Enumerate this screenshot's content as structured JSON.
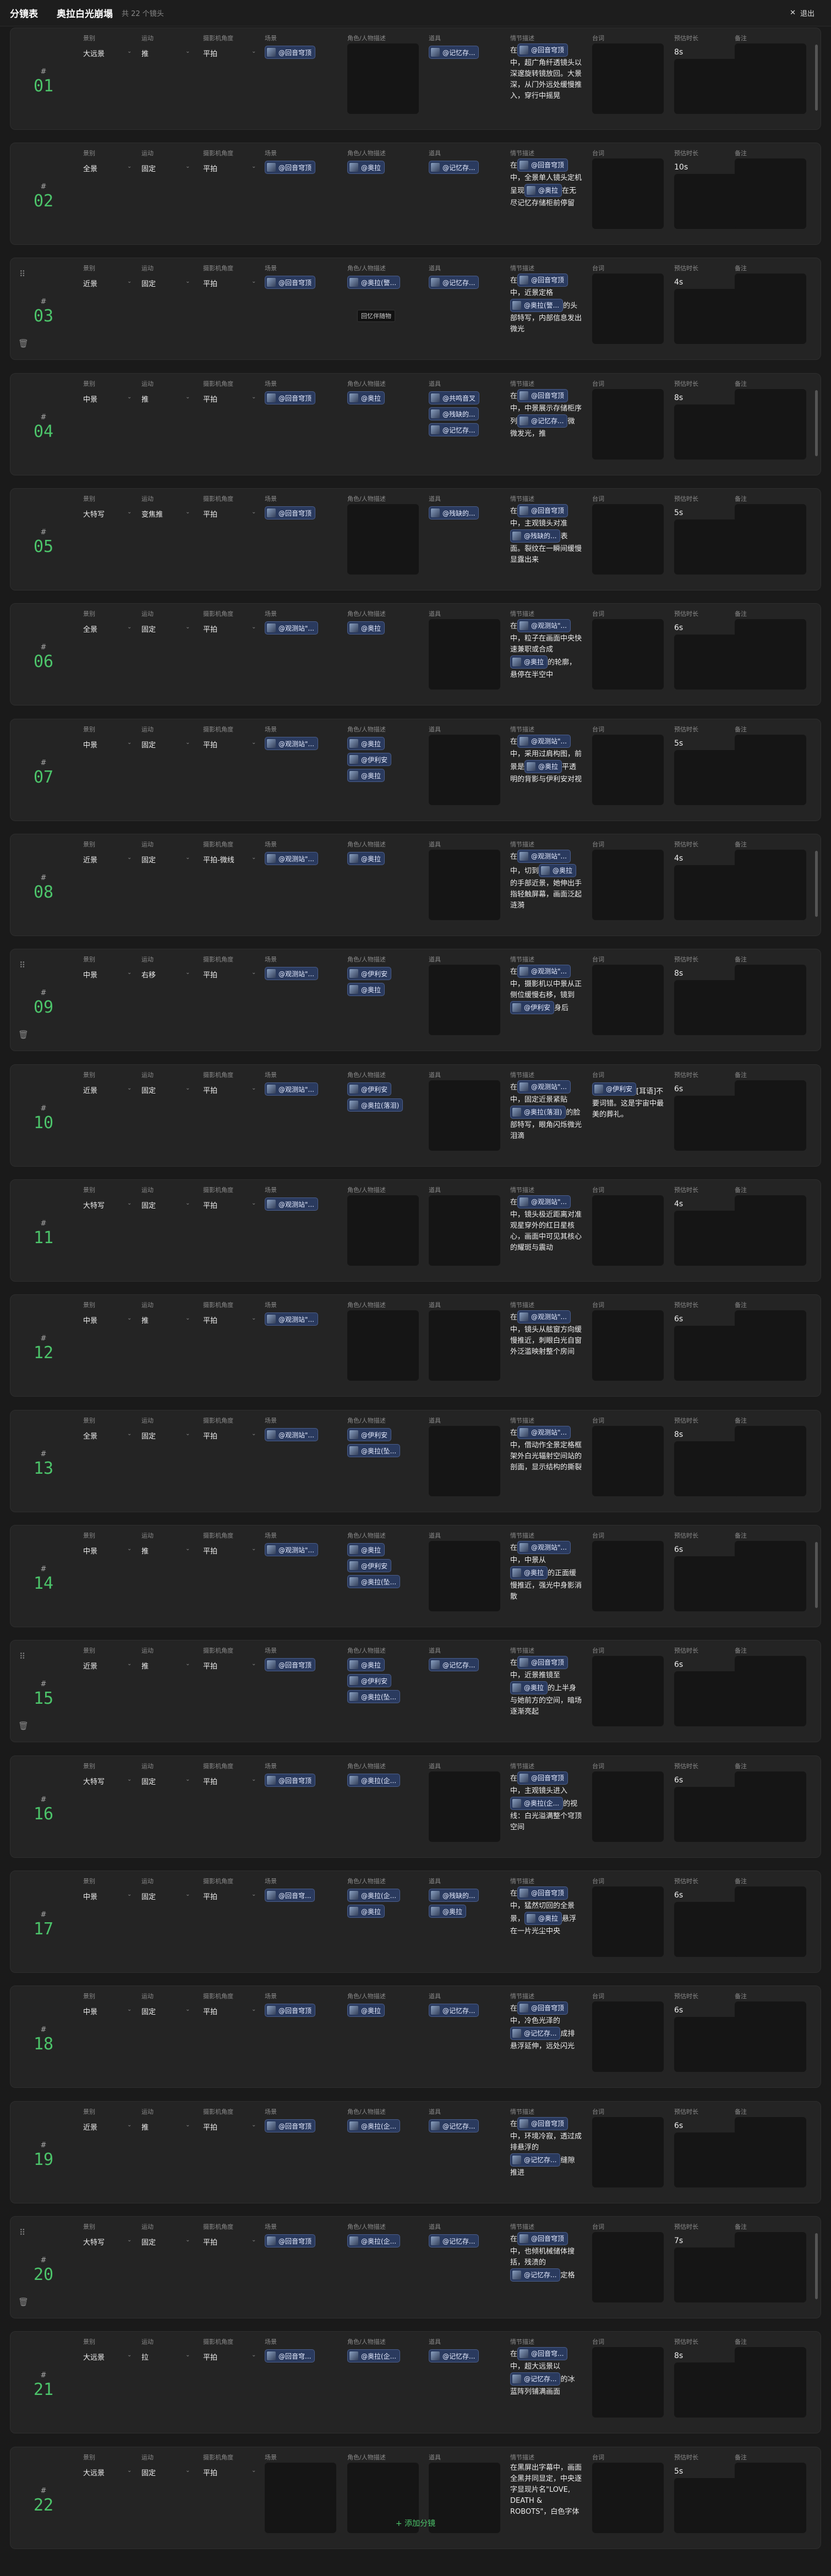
{
  "header": {
    "title": "分镜表",
    "project": "奥拉白光崩塌",
    "count": "共 22 个镜头",
    "exit": "退出",
    "exit_icon": "close-icon"
  },
  "labels": {
    "shot": "景别",
    "move": "运动",
    "angle": "摄影机角度",
    "scene": "场景",
    "char": "角色/人物描述",
    "prop": "道具",
    "plot": "情节描述",
    "line": "台词",
    "dur": "预估时长",
    "note": "备注"
  },
  "add_button": "+ 添加分镜",
  "tooltip": "回忆伴随物",
  "rows": [
    {
      "no": "01",
      "shot": "大远景",
      "move": "推",
      "angle": "平拍",
      "scene": [
        "@回音穹顶"
      ],
      "chars": [],
      "props": [
        "@记忆存..."
      ],
      "plot": [
        [
          "t",
          "在"
        ],
        [
          "c",
          "@回音穹顶"
        ],
        [
          "t",
          "中，超广角纤透镜头以深邃旋转镜放回。大景深，从门外远处缓慢推入，穿行中摇晃"
        ]
      ],
      "dur": "8s",
      "line": "",
      "tools": false
    },
    {
      "no": "02",
      "shot": "全景",
      "move": "固定",
      "angle": "平拍",
      "scene": [
        "@回音穹顶"
      ],
      "chars": [
        "@奥拉"
      ],
      "props": [
        "@记忆存..."
      ],
      "plot": [
        [
          "t",
          "在"
        ],
        [
          "c",
          "@回音穹顶"
        ],
        [
          "t",
          "中，全景单人镜头定机呈现"
        ],
        [
          "c",
          "@奥拉"
        ],
        [
          "t",
          "在无尽记忆存储柜前停留"
        ]
      ],
      "dur": "10s",
      "line": "",
      "tools": false
    },
    {
      "no": "03",
      "shot": "近景",
      "move": "固定",
      "angle": "平拍",
      "scene": [
        "@回音穹顶"
      ],
      "chars": [
        "@奥拉(警..."
      ],
      "props": [
        "@记忆存..."
      ],
      "plot": [
        [
          "t",
          "在"
        ],
        [
          "c",
          "@回音穹顶"
        ],
        [
          "t",
          "中，近景定格"
        ],
        [
          "c",
          "@奥拉(警..."
        ],
        [
          "t",
          "的头部特写，内部信息发出微光"
        ]
      ],
      "dur": "4s",
      "line": "",
      "tools": true
    },
    {
      "no": "04",
      "shot": "中景",
      "move": "推",
      "angle": "平拍",
      "scene": [
        "@回音穹顶"
      ],
      "chars": [
        "@奥拉"
      ],
      "props": [
        "@共鸣音叉",
        "@残缺的...",
        "@记忆存..."
      ],
      "plot": [
        [
          "t",
          "在"
        ],
        [
          "c",
          "@回音穹顶"
        ],
        [
          "t",
          "中，中景展示存储柜序列"
        ],
        [
          "c",
          "@记忆存..."
        ],
        [
          "t",
          "微微发光，推"
        ]
      ],
      "dur": "8s",
      "line": "",
      "tools": false
    },
    {
      "no": "05",
      "shot": "大特写",
      "move": "变焦推",
      "angle": "平拍",
      "scene": [
        "@回音穹顶"
      ],
      "chars": [],
      "props": [
        "@残缺的..."
      ],
      "plot": [
        [
          "t",
          "在"
        ],
        [
          "c",
          "@回音穹顶"
        ],
        [
          "t",
          "中，主观镜头对准"
        ],
        [
          "c",
          "@残缺的..."
        ],
        [
          "t",
          "表面。裂纹在一瞬间缓慢显露出来"
        ]
      ],
      "dur": "5s",
      "line": "",
      "tools": false
    },
    {
      "no": "06",
      "shot": "全景",
      "move": "固定",
      "angle": "平拍",
      "scene": [
        "@观测站\"..."
      ],
      "chars": [
        "@奥拉"
      ],
      "props": [],
      "plot": [
        [
          "t",
          "在"
        ],
        [
          "c",
          "@观测站\"..."
        ],
        [
          "t",
          "中，粒子在画面中央快速兼职或合成"
        ],
        [
          "c",
          "@奥拉"
        ],
        [
          "t",
          "的轮廓，悬停在半空中"
        ]
      ],
      "dur": "6s",
      "line": "",
      "tools": false
    },
    {
      "no": "07",
      "shot": "中景",
      "move": "固定",
      "angle": "平拍",
      "scene": [
        "@观测站\"..."
      ],
      "chars": [
        "@奥拉",
        "@伊利安",
        "@奥拉"
      ],
      "props": [],
      "plot": [
        [
          "t",
          "在"
        ],
        [
          "c",
          "@观测站\"..."
        ],
        [
          "t",
          "中，采用过肩构图，前景是"
        ],
        [
          "c",
          "@奥拉"
        ],
        [
          "t",
          "平透明的背影与伊利安对视"
        ]
      ],
      "dur": "5s",
      "line": "",
      "tools": false
    },
    {
      "no": "08",
      "shot": "近景",
      "move": "固定",
      "angle": "平拍-微线",
      "scene": [
        "@观测站\"..."
      ],
      "chars": [
        "@奥拉"
      ],
      "props": [],
      "plot": [
        [
          "t",
          "在"
        ],
        [
          "c",
          "@观测站\"..."
        ],
        [
          "t",
          "中，切到"
        ],
        [
          "c",
          "@奥拉"
        ],
        [
          "t",
          "的手部近景，她伸出手指轻触屏幕，画面泛起涟漪"
        ]
      ],
      "dur": "4s",
      "line": "",
      "tools": false
    },
    {
      "no": "09",
      "shot": "中景",
      "move": "右移",
      "angle": "平拍",
      "scene": [
        "@观测站\"..."
      ],
      "chars": [
        "@伊利安",
        "@奥拉"
      ],
      "props": [],
      "plot": [
        [
          "t",
          "在"
        ],
        [
          "c",
          "@观测站\"..."
        ],
        [
          "t",
          "中，摄影机以中景从正侧位缓慢右移，镜到"
        ],
        [
          "c",
          "@伊利安"
        ],
        [
          "t",
          "身后"
        ]
      ],
      "dur": "8s",
      "line": "",
      "tools": true
    },
    {
      "no": "10",
      "shot": "近景",
      "move": "固定",
      "angle": "平拍",
      "scene": [
        "@观测站\"..."
      ],
      "chars": [
        "@伊利安",
        "@奥拉(落泪)"
      ],
      "props": [],
      "plot": [
        [
          "t",
          "在"
        ],
        [
          "c",
          "@观测站\"..."
        ],
        [
          "t",
          "中，固定近景紧贴"
        ],
        [
          "c",
          "@奥拉(落泪)"
        ],
        [
          "t",
          "的脸部特写，眼角闪烁微光泪滴"
        ]
      ],
      "dur": "6s",
      "line": "[耳语]不要词错。这是宇宙中最美的葬礼。",
      "line_chip": "@伊利安",
      "tools": false
    },
    {
      "no": "11",
      "shot": "大特写",
      "move": "固定",
      "angle": "平拍",
      "scene": [
        "@观测站\"..."
      ],
      "chars": [],
      "props": [],
      "plot": [
        [
          "t",
          "在"
        ],
        [
          "c",
          "@观测站\"..."
        ],
        [
          "t",
          "中，镜头极近距离对准观星穿外的红日星核心，画面中可见其核心的耀斑与震动"
        ]
      ],
      "dur": "4s",
      "line": "",
      "tools": false
    },
    {
      "no": "12",
      "shot": "中景",
      "move": "推",
      "angle": "平拍",
      "scene": [
        "@观测站\"..."
      ],
      "chars": [],
      "props": [],
      "plot": [
        [
          "t",
          "在"
        ],
        [
          "c",
          "@观测站\"..."
        ],
        [
          "t",
          "中，镜头从舷窗方向缓慢推近，刺眼白光自窗外泛滥映射整个房间"
        ]
      ],
      "dur": "6s",
      "line": "",
      "tools": false
    },
    {
      "no": "13",
      "shot": "全景",
      "move": "固定",
      "angle": "平拍",
      "scene": [
        "@观测站\"..."
      ],
      "chars": [
        "@伊利安",
        "@奥拉(坠..."
      ],
      "props": [],
      "plot": [
        [
          "t",
          "在"
        ],
        [
          "c",
          "@观测站\"..."
        ],
        [
          "t",
          "中，借动作全景定格框架外白光辐射空间站的剖面，显示结构的撕裂"
        ]
      ],
      "dur": "8s",
      "line": "",
      "tools": false
    },
    {
      "no": "14",
      "shot": "中景",
      "move": "推",
      "angle": "平拍",
      "scene": [
        "@观测站\"..."
      ],
      "chars": [
        "@奥拉",
        "@伊利安",
        "@奥拉(坠..."
      ],
      "props": [],
      "plot": [
        [
          "t",
          "在"
        ],
        [
          "c",
          "@观测站\"..."
        ],
        [
          "t",
          "中，中景从"
        ],
        [
          "c",
          "@奥拉"
        ],
        [
          "t",
          "的正面缓慢推近，强光中身影消散"
        ]
      ],
      "dur": "6s",
      "line": "",
      "tools": false
    },
    {
      "no": "15",
      "shot": "近景",
      "move": "推",
      "angle": "平拍",
      "scene": [
        "@回音穹顶"
      ],
      "chars": [
        "@奥拉",
        "@伊利安",
        "@奥拉(坠..."
      ],
      "props": [
        "@记忆存..."
      ],
      "plot": [
        [
          "t",
          "在"
        ],
        [
          "c",
          "@回音穹顶"
        ],
        [
          "t",
          "中，近景推镜至"
        ],
        [
          "c",
          "@奥拉"
        ],
        [
          "t",
          "的上半身与她前方的空间，暗场逐渐亮起"
        ]
      ],
      "dur": "6s",
      "line": "",
      "tools": true
    },
    {
      "no": "16",
      "shot": "大特写",
      "move": "固定",
      "angle": "平拍",
      "scene": [
        "@回音穹顶"
      ],
      "chars": [
        "@奥拉(企..."
      ],
      "props": [],
      "plot": [
        [
          "t",
          "在"
        ],
        [
          "c",
          "@回音穹顶"
        ],
        [
          "t",
          "中，主观镜头进入"
        ],
        [
          "c",
          "@奥拉(企..."
        ],
        [
          "t",
          "的视线：白光溢满整个穹顶空间"
        ]
      ],
      "dur": "6s",
      "line": "",
      "tools": false
    },
    {
      "no": "17",
      "shot": "中景",
      "move": "固定",
      "angle": "平拍",
      "scene": [
        "@回音穹..."
      ],
      "chars": [
        "@奥拉(企...",
        "@奥拉"
      ],
      "props": [
        "@残缺的...",
        "@奥拉"
      ],
      "plot": [
        [
          "t",
          "在"
        ],
        [
          "c",
          "@回音穹顶"
        ],
        [
          "t",
          "中，猛然切回的全景景，"
        ],
        [
          "c",
          "@奥拉"
        ],
        [
          "t",
          "悬浮在一片光尘中央"
        ]
      ],
      "dur": "6s",
      "line": "",
      "tools": false
    },
    {
      "no": "18",
      "shot": "中景",
      "move": "固定",
      "angle": "平拍",
      "scene": [
        "@回音穹顶"
      ],
      "chars": [
        "@奥拉"
      ],
      "props": [
        "@记忆存..."
      ],
      "plot": [
        [
          "t",
          "在"
        ],
        [
          "c",
          "@回音穹顶"
        ],
        [
          "t",
          "中，冷色光泽的"
        ],
        [
          "c",
          "@记忆存..."
        ],
        [
          "t",
          "成排悬浮延伸，远处闪光"
        ]
      ],
      "dur": "6s",
      "line": "",
      "tools": false
    },
    {
      "no": "19",
      "shot": "近景",
      "move": "推",
      "angle": "平拍",
      "scene": [
        "@回音穹顶"
      ],
      "chars": [
        "@奥拉(企..."
      ],
      "props": [
        "@记忆存..."
      ],
      "plot": [
        [
          "t",
          "在"
        ],
        [
          "c",
          "@回音穹顶"
        ],
        [
          "t",
          "中，环境冷寂，透过成排悬浮的"
        ],
        [
          "c",
          "@记忆存..."
        ],
        [
          "t",
          "缝隙推进"
        ]
      ],
      "dur": "6s",
      "line": "",
      "tools": false
    },
    {
      "no": "20",
      "shot": "大特写",
      "move": "固定",
      "angle": "平拍",
      "scene": [
        "@回音穹顶"
      ],
      "chars": [
        "@奥拉(企..."
      ],
      "props": [
        "@记忆存..."
      ],
      "plot": [
        [
          "t",
          "在"
        ],
        [
          "c",
          "@回音穹顶"
        ],
        [
          "t",
          "中，也倾机械储体搜括，残渍的"
        ],
        [
          "c",
          "@记忆存..."
        ],
        [
          "t",
          "定格"
        ]
      ],
      "dur": "7s",
      "line": "",
      "tools": true
    },
    {
      "no": "21",
      "shot": "大远景",
      "move": "拉",
      "angle": "平拍",
      "scene": [
        "@回音穹..."
      ],
      "chars": [
        "@奥拉(企..."
      ],
      "props": [
        "@记忆存..."
      ],
      "plot": [
        [
          "t",
          "在"
        ],
        [
          "c",
          "@回音穹..."
        ],
        [
          "t",
          "中，超大远景以"
        ],
        [
          "c",
          "@记忆存..."
        ],
        [
          "t",
          "的冰蓝阵列铺满画面"
        ]
      ],
      "dur": "8s",
      "line": "",
      "tools": false
    },
    {
      "no": "22",
      "shot": "大远景",
      "move": "固定",
      "angle": "平拍",
      "scene": [],
      "chars": [],
      "props": [],
      "plot": [
        [
          "t",
          "在黑屏出字幕中，画面全黑并同显定，中央逐字显现片名\"LOVE, DEATH & ROBOTS\"，白色字体"
        ]
      ],
      "dur": "5s",
      "line": "",
      "tools": false
    }
  ]
}
